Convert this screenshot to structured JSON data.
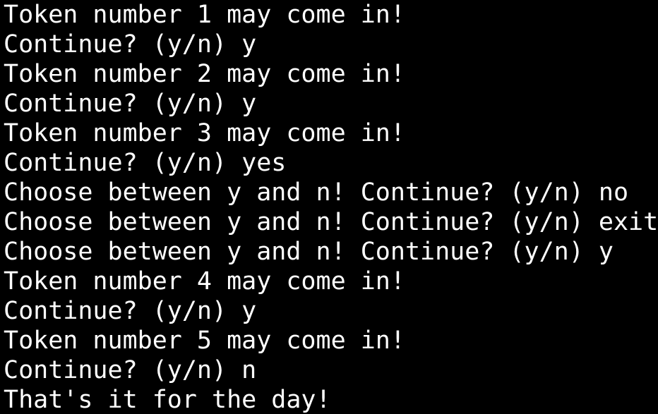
{
  "terminal": {
    "lines": [
      "Token number 1 may come in!",
      "Continue? (y/n) y",
      "Token number 2 may come in!",
      "Continue? (y/n) y",
      "Token number 3 may come in!",
      "Continue? (y/n) yes",
      "Choose between y and n! Continue? (y/n) no",
      "Choose between y and n! Continue? (y/n) exit",
      "Choose between y and n! Continue? (y/n) y",
      "Token number 4 may come in!",
      "Continue? (y/n) y",
      "Token number 5 may come in!",
      "Continue? (y/n) n",
      "That's it for the day!"
    ]
  },
  "colors": {
    "background": "#000000",
    "foreground": "#ffffff"
  }
}
